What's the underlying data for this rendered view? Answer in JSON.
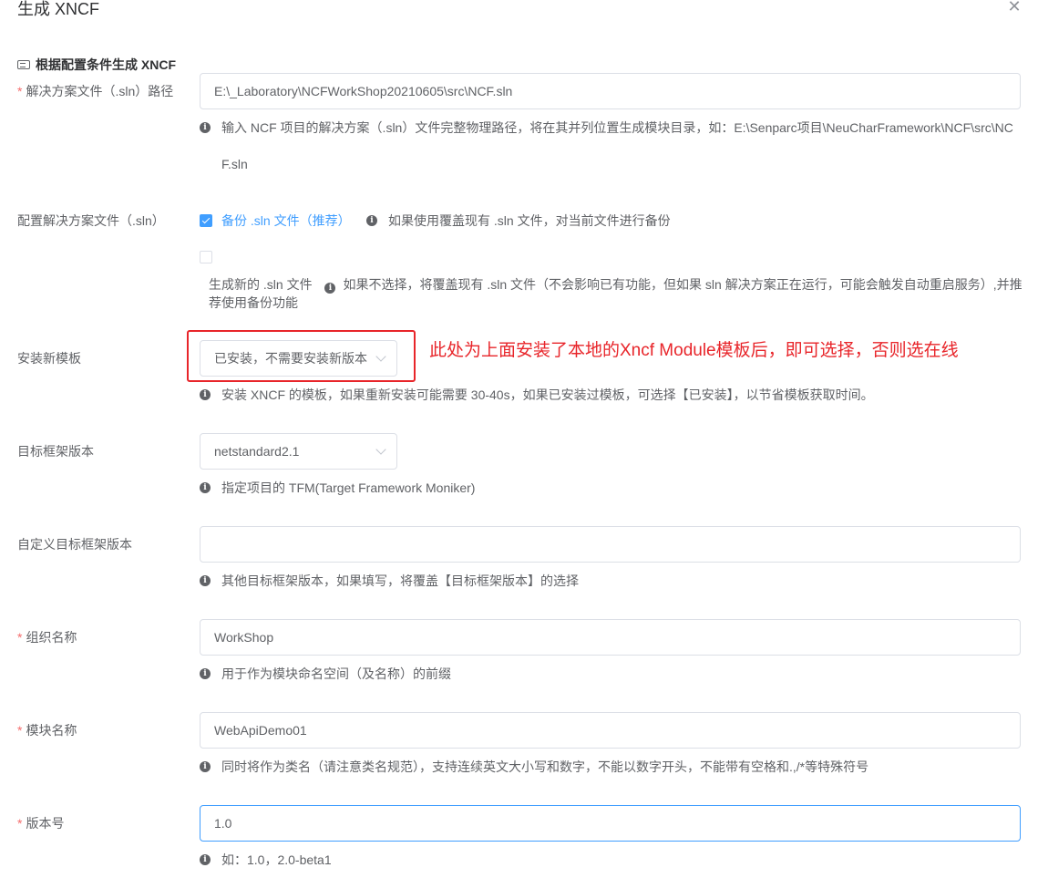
{
  "dialog": {
    "title": "生成 XNCF",
    "close_icon": "close-icon"
  },
  "section": {
    "title": "根据配置条件生成 XNCF",
    "icon": "form-icon"
  },
  "colors": {
    "required": "#f56c6c",
    "accent": "#409eff",
    "annotation": "#e8252a"
  },
  "fields": {
    "sln_path": {
      "required": "*",
      "label": "解决方案文件（.sln）路径",
      "value": "E:\\_Laboratory\\NCFWorkShop20210605\\src\\NCF.sln",
      "hint": "输入 NCF 项目的解决方案（.sln）文件完整物理路径，将在其并列位置生成模块目录，如：E:\\Senparc项目\\NeuCharFramework\\NCF\\src\\NCF.sln"
    },
    "sln_config": {
      "label": "配置解决方案文件（.sln）",
      "backup_label": "备份 .sln 文件（推荐）",
      "backup_checked": true,
      "backup_hint": "如果使用覆盖现有 .sln 文件，对当前文件进行备份",
      "new_label": "生成新的 .sln 文件",
      "new_checked": false,
      "new_hint": "如果不选择，将覆盖现有 .sln 文件（不会影响已有功能，但如果 sln 解决方案正在运行，可能会触发自动重启服务）,并推荐使用备份功能"
    },
    "template": {
      "label": "安装新模板",
      "value": "已安装，不需要安装新版本",
      "hint": "安装 XNCF 的模板，如果重新安装可能需要 30-40s，如果已安装过模板，可选择【已安装】，以节省模板获取时间。"
    },
    "framework": {
      "label": "目标框架版本",
      "value": "netstandard2.1",
      "hint": "指定项目的 TFM(Target Framework Moniker)"
    },
    "custom_framework": {
      "label": "自定义目标框架版本",
      "value": "",
      "hint": "其他目标框架版本，如果填写，将覆盖【目标框架版本】的选择"
    },
    "org_name": {
      "required": "*",
      "label": "组织名称",
      "value": "WorkShop",
      "hint": "用于作为模块命名空间（及名称）的前缀"
    },
    "module_name": {
      "required": "*",
      "label": "模块名称",
      "value": "WebApiDemo01",
      "hint": "同时将作为类名（请注意类名规范），支持连续英文大小写和数字，不能以数字开头，不能带有空格和.,/*等特殊符号"
    },
    "version": {
      "required": "*",
      "label": "版本号",
      "value": "1.0",
      "hint": "如：1.0，2.0-beta1"
    }
  },
  "annotation": {
    "text": "此处为上面安装了本地的Xncf Module模板后，即可选择，否则选在线"
  }
}
